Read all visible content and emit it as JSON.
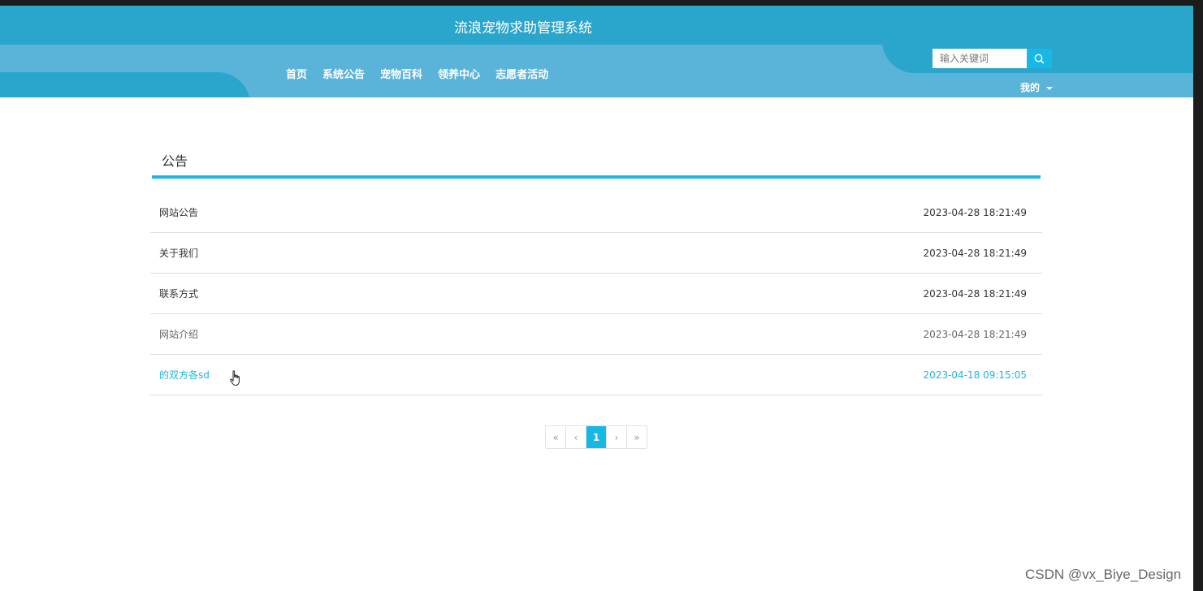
{
  "header": {
    "site_title": "流浪宠物求助管理系统",
    "nav": [
      "首页",
      "系统公告",
      "宠物百科",
      "领养中心",
      "志愿者活动"
    ],
    "active_nav": "系统公告",
    "search_placeholder": "输入关键词",
    "user_menu": "我的"
  },
  "main": {
    "section_title": "公告",
    "items": [
      {
        "title": "网站公告",
        "time": "2023-04-28 18:21:49"
      },
      {
        "title": "关于我们",
        "time": "2023-04-28 18:21:49"
      },
      {
        "title": "联系方式",
        "time": "2023-04-28 18:21:49"
      },
      {
        "title": "网站介绍",
        "time": "2023-04-28 18:21:49"
      },
      {
        "title": "的双方各sd",
        "time": "2023-04-18 09:15:05"
      }
    ]
  },
  "pagination": {
    "first": "«",
    "prev": "‹",
    "current": "1",
    "next": "›",
    "last": "»"
  },
  "watermark": "CSDN @vx_Biye_Design",
  "colors": {
    "header_dark": "#2aa5cc",
    "header_light": "#5ab3d8",
    "accent": "#1db5e0"
  }
}
